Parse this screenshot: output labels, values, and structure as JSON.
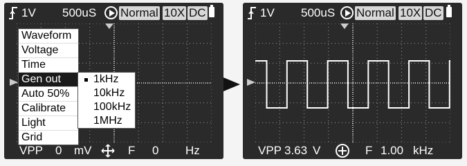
{
  "left": {
    "topbar": {
      "volts_div": "1V",
      "time_div": "500uS",
      "mode": "Normal",
      "probe": "10X",
      "coupling": "DC"
    },
    "menu": {
      "items": [
        "Waveform",
        "Voltage",
        "Time",
        "Gen out",
        "Auto 50%",
        "Calibrate",
        "Light",
        "Grid"
      ],
      "active": "Gen out"
    },
    "submenu": {
      "items": [
        "1kHz",
        "10kHz",
        "100kHz",
        "1MHz"
      ],
      "selected": "1kHz"
    },
    "bottombar": {
      "vpp_label": "VPP",
      "vpp_value": "0",
      "vpp_unit": "mV",
      "freq_label": "F",
      "freq_value": "0",
      "freq_unit": "Hz"
    }
  },
  "right": {
    "topbar": {
      "volts_div": "1V",
      "time_div": "500uS",
      "mode": "Normal",
      "probe": "10X",
      "coupling": "DC"
    },
    "bottombar": {
      "vpp_label": "VPP",
      "vpp_value": "3.63",
      "vpp_unit": "V",
      "freq_label": "F",
      "freq_value": "1.00",
      "freq_unit": "kHz"
    },
    "waveform": {
      "type": "square",
      "cycles": 4.5
    }
  },
  "colors": {
    "screen_bg": "#2a2a2a",
    "trace": "#ffffff",
    "grid_dot": "#9a9a9a",
    "menu_bg": "#ffffff"
  },
  "icons": {
    "trigger": "trigger-edge-icon",
    "run": "play-icon",
    "battery": "battery-icon",
    "move": "move-cross-icon",
    "position": "crosshair-circle-icon",
    "transition": "right-arrow-icon"
  }
}
